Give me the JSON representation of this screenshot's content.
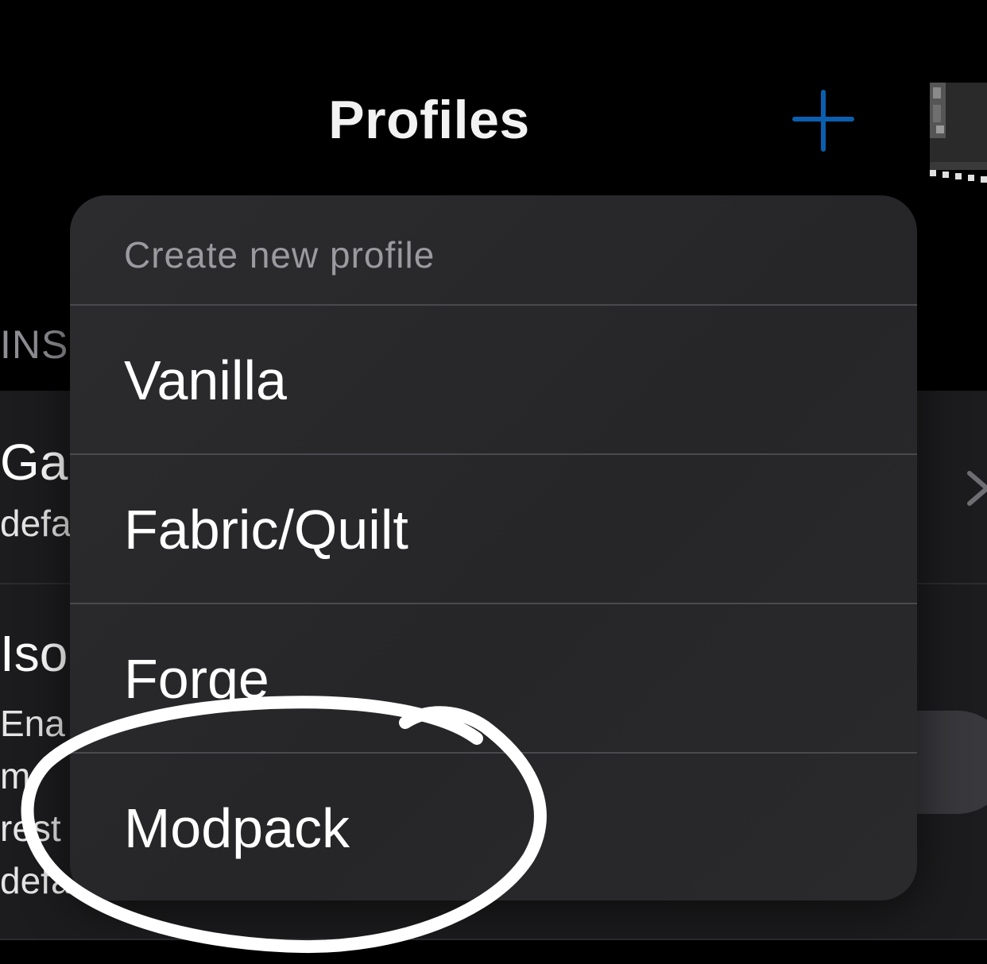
{
  "nav": {
    "title": "Profiles",
    "add_icon": "plus-icon",
    "avatar_icon": "player-head-avatar"
  },
  "background": {
    "section_header": "INS",
    "rows": [
      {
        "title": "Ga",
        "subtitle": "defa"
      },
      {
        "title": "Iso",
        "subtitle_lines": [
          "Ena",
          "m",
          "rest",
          "defa"
        ]
      }
    ]
  },
  "menu": {
    "header": "Create new profile",
    "items": [
      {
        "label": "Vanilla"
      },
      {
        "label": "Fabric/Quilt"
      },
      {
        "label": "Forge"
      },
      {
        "label": "Modpack"
      }
    ]
  },
  "colors": {
    "accent": "#0a5fae",
    "menu_background": "#2c2c2e",
    "annotation": "#ffffff"
  }
}
